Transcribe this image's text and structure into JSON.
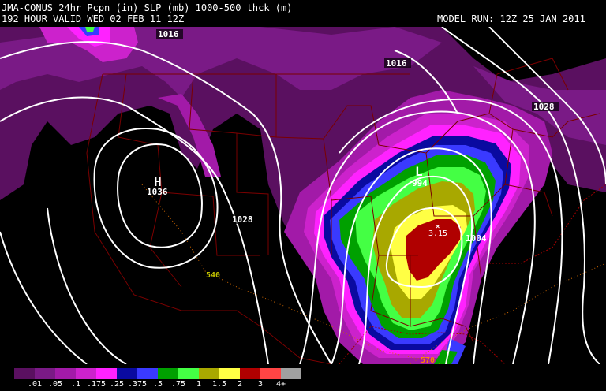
{
  "header": {
    "line1": "JMA-CONUS 24hr Pcpn (in) SLP (mb) 1000-500 thck (m)",
    "line2": "192 HOUR VALID WED 02 FEB 11 12Z",
    "model_run": "MODEL RUN: 12Z 25 JAN 2011"
  },
  "map": {
    "pressure_labels": [
      "1016",
      "1016",
      "1028",
      "1028",
      "994",
      "1004",
      "1036"
    ],
    "highs": [
      {
        "symbol": "H",
        "value": "1036"
      }
    ],
    "lows": [
      {
        "symbol": "L",
        "value": "994"
      }
    ],
    "thickness_labels": [
      "540",
      "570"
    ],
    "max_precip_label": "3.15"
  },
  "legend": {
    "ticks": [
      ".01",
      ".05",
      ".1",
      ".175",
      ".25",
      ".375",
      ".5",
      ".75",
      "1",
      "1.5",
      "2",
      "3",
      "4+"
    ],
    "colors": [
      "#5a1060",
      "#7a1a86",
      "#a21aa8",
      "#cc22cc",
      "#ff22ff",
      "#0a0aa0",
      "#3a3aff",
      "#00a000",
      "#44ff44",
      "#a8a800",
      "#ffff44",
      "#b00000",
      "#ff4444",
      "#a0a0a0"
    ]
  }
}
